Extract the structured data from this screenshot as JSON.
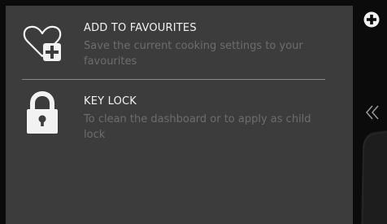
{
  "menu": {
    "items": [
      {
        "title": "ADD TO FAVOURITES",
        "description": "Save the current cooking settings to your favourites",
        "icon": "heart-plus-icon"
      },
      {
        "title": "KEY LOCK",
        "description": "To clean the dashboard or to apply as child lock",
        "icon": "padlock-icon"
      }
    ]
  },
  "sidebar": {
    "add_icon": "plus-circle-icon",
    "collapse_icon": "double-chevron-left-icon"
  },
  "colors": {
    "panel_background": "#3c3c3c",
    "title_text": "#f2f2f2",
    "description_text": "#6d6d6d",
    "screen_background": "#0b0b0b"
  }
}
